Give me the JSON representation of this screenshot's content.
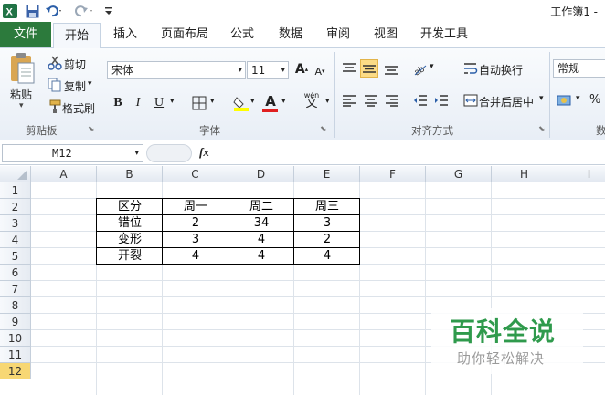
{
  "window": {
    "title": "工作簿1 -"
  },
  "tabs": {
    "file": "文件",
    "home": "开始",
    "insert": "插入",
    "page_layout": "页面布局",
    "formulas": "公式",
    "data": "数据",
    "review": "审阅",
    "view": "视图",
    "developer": "开发工具"
  },
  "ribbon": {
    "clipboard": {
      "paste": "粘贴",
      "cut": "剪切",
      "copy": "复制",
      "format_painter": "格式刷",
      "label": "剪贴板"
    },
    "font": {
      "name": "宋体",
      "size": "11",
      "bold": "B",
      "italic": "I",
      "underline": "U",
      "grow": "A",
      "shrink": "A",
      "phonetic": "wén",
      "label": "字体"
    },
    "alignment": {
      "wrap_text": "自动换行",
      "merge_center": "合并后居中",
      "label": "对齐方式"
    },
    "number": {
      "format": "常规",
      "percent": "%",
      "label": "数"
    }
  },
  "formula_bar": {
    "name_box": "M12",
    "fx": "fx"
  },
  "sheet": {
    "columns": [
      "A",
      "B",
      "C",
      "D",
      "E",
      "F",
      "G",
      "H",
      "I"
    ],
    "rows": [
      "1",
      "2",
      "3",
      "4",
      "5",
      "6",
      "7",
      "8",
      "9",
      "10",
      "11",
      "12"
    ],
    "selected_row": "12",
    "table": {
      "header": [
        "区分",
        "周一",
        "周二",
        "周三"
      ],
      "rows": [
        [
          "错位",
          "2",
          "34",
          "3"
        ],
        [
          "变形",
          "3",
          "4",
          "2"
        ],
        [
          "开裂",
          "4",
          "4",
          "4"
        ]
      ]
    }
  },
  "watermark": {
    "title": "百科全说",
    "subtitle": "助你轻松解决",
    "title_color": "#2f9a4c"
  },
  "colors": {
    "file_tab": "#2c7a3c",
    "selected_row": "#f7d774",
    "excel_green": "#217346"
  }
}
